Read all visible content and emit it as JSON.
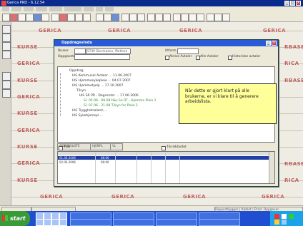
{
  "window": {
    "title": "Gerica PRD - 6.12.54"
  },
  "menu": {
    "items": [
      "",
      "",
      "",
      "",
      "",
      "",
      "",
      "",
      ""
    ]
  },
  "workspace": {
    "watermark_gerica": "GERICA",
    "watermark_kurse": "KURSE",
    "watermark_rbase": "RBASE",
    "watermark_rica": "RICA"
  },
  "dialog": {
    "title": "Oppdragsvindu",
    "field_label_1": "Bruker",
    "field_value_1": "5749 Sturmaann, Mottsse",
    "field_label_2": "Oppgavetr",
    "right_field_label": "Utform",
    "checkbox_1": "Aktive Avtaler",
    "checkbox_2": "Alle Avtaler",
    "checkbox_3": "Historiske avtaler",
    "tree": [
      {
        "text": "Oppdrag",
        "color": "default"
      },
      {
        "text": "IAS  Kommunal Avtaler ...  11.06.2007",
        "color": "default"
      },
      {
        "text": "IAS  Hjemmesykepleie ...  04.07.2007",
        "color": "default"
      },
      {
        "text": "IAS  Hjemmehjelp ...  17.10.2007",
        "color": "default"
      },
      {
        "text": "Tilsyn",
        "color": "default"
      },
      {
        "text": "IAS  SR PR - Dagsenter ... 17.06.2006",
        "color": "default"
      },
      {
        "text": "Si: 05.06 - 09.08 tl&s Se RT - Hjemme Pleie 1",
        "color": "green"
      },
      {
        "text": "Si: 07.06 - 21.08 Tilsyn for Pleie 2",
        "color": "green"
      },
      {
        "text": "IAS  Trygghetsalarm ...",
        "color": "default"
      },
      {
        "text": "IAS  Sykehjemspl ...",
        "color": "default"
      }
    ],
    "tabs": [
      "ARBEIDSLISTE",
      "HJEMPL",
      "VL"
    ],
    "grid_header_label": "Tids",
    "right_header_label": "Tils-Aktivitet",
    "grid_rows": [
      {
        "c1": "01.06.2006",
        "c2": "",
        "c3": "08:00",
        "c4": "",
        "selected": true
      },
      {
        "c1": "02.06.2006",
        "c2": "",
        "c3": "08:00",
        "c4": "",
        "selected": false
      }
    ]
  },
  "tooltip": {
    "text": "Når dette er gjort klart på alle brukerne, er vi klare til å generere arbeidslista."
  },
  "statusbar": {
    "left": "",
    "right": "Rapportbygger | Koblet | Prod. Oppgaver"
  },
  "taskbar": {
    "start_label": "start",
    "tasks": [
      "",
      "",
      "",
      "",
      "",
      "",
      "",
      ""
    ],
    "clock": ""
  },
  "colors": {
    "titlebar": "#0a2a8c",
    "dialog_title": "#2a5bd7",
    "tooltip_bg": "#ffff99",
    "taskbar": "#1f4fd0",
    "start_green": "#3a9a3a"
  }
}
